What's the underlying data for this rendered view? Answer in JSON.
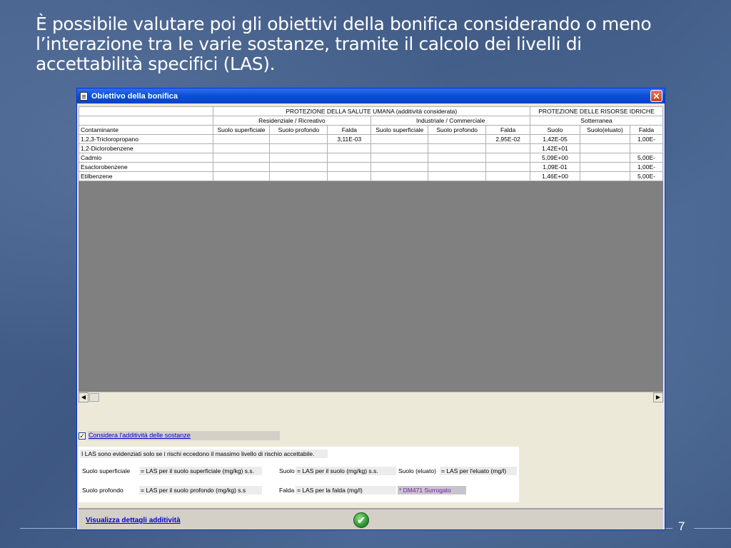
{
  "slide": {
    "text": "È possibile valutare poi gli obiettivi della bonifica considerando o meno l’interazione tra le varie sostanze, tramite il calcolo dei livelli di accettabilità specifici (LAS).",
    "page_number": "7"
  },
  "window": {
    "title": "Obiettivo della bonifica",
    "close_icon": "close-icon",
    "app_icon": "document-icon"
  },
  "grid": {
    "group_headers": {
      "health": "PROTEZIONE DELLA SALUTE UMANA (additività considerata)",
      "water": "PROTEZIONE DELLE RISORSE IDRICHE"
    },
    "sub_headers": {
      "residential": "Residenziale / Ricreativo",
      "industrial": "Industriale / Commerciale",
      "groundwater": "Sotterranea"
    },
    "columns": [
      "Contaminante",
      "Suolo superficiale",
      "Suolo profondo",
      "Falda",
      "Suolo superficiale",
      "Suolo profondo",
      "Falda",
      "Suolo",
      "Suolo(eluato)",
      "Falda"
    ],
    "rows": [
      [
        "1,2,3-Tricloropropano",
        "",
        "",
        "3,11E-03",
        "",
        "",
        "2,95E-02",
        "1,42E-05",
        "",
        "1,00E-"
      ],
      [
        "1,2-Diclorobenzene",
        "",
        "",
        "",
        "",
        "",
        "",
        "1,42E+01",
        "",
        ""
      ],
      [
        "Cadmio",
        "",
        "",
        "",
        "",
        "",
        "",
        "5,09E+00",
        "",
        "5,00E-"
      ],
      [
        "Esaclorobenzene",
        "",
        "",
        "",
        "",
        "",
        "",
        "1,09E-01",
        "",
        "1,00E-"
      ],
      [
        "Etilbenzene",
        "",
        "",
        "",
        "",
        "",
        "",
        "1,46E+00",
        "",
        "5,00E-"
      ]
    ]
  },
  "options": {
    "consider_additivity": "Considera l'additività delle sostanze",
    "checked_mark": "✓"
  },
  "legend": {
    "note": "I LAS sono evidenziati solo se i rischi eccedono il massimo livello di rischio accettabile.",
    "suolo_sup": "Suolo superficiale",
    "suolo_sup_def": "= LAS per il suolo superficiale (mg/kg) s.s.",
    "suolo": "Suolo",
    "suolo_def": "=   LAS per il suolo (mg/kg) s.s.",
    "eluato": "Suolo (eluato)",
    "eluato_def": "=   LAS per l'eluato (mg/l)",
    "suolo_prof": "Suolo profondo",
    "suolo_prof_def": "= LAS per il suolo profondo (mg/kg) s.s",
    "falda": "Falda",
    "falda_def": "=   LAS per la falda (mg/l)",
    "dm471": "* DM471 Surrogato"
  },
  "footer": {
    "details_link": "Visualizza dettagli additività",
    "ok_icon": "checkmark-icon",
    "ok_glyph": "✔"
  }
}
